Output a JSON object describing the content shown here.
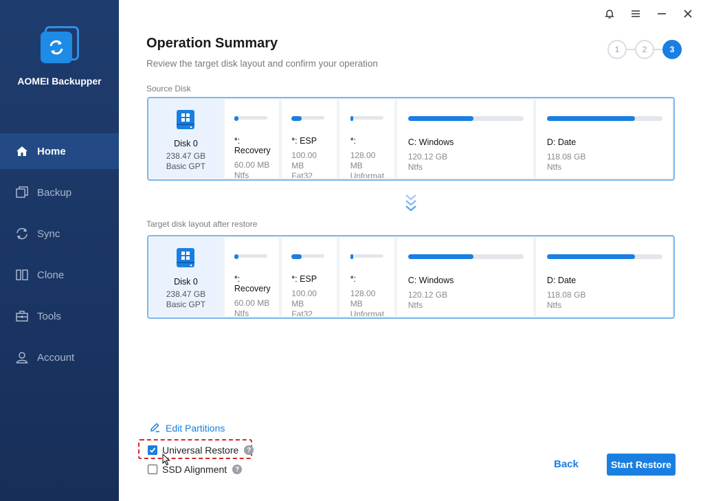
{
  "app": {
    "brand": "AOMEI Backupper"
  },
  "sidebar": {
    "items": [
      {
        "label": "Home",
        "icon": "home-icon",
        "active": true
      },
      {
        "label": "Backup",
        "icon": "backup-icon"
      },
      {
        "label": "Sync",
        "icon": "sync-icon"
      },
      {
        "label": "Clone",
        "icon": "clone-icon"
      },
      {
        "label": "Tools",
        "icon": "tools-icon"
      },
      {
        "label": "Account",
        "icon": "account-icon"
      }
    ]
  },
  "header": {
    "title": "Operation Summary",
    "subtitle": "Review the target disk layout and confirm your operation",
    "steps": [
      "1",
      "2",
      "3"
    ],
    "active_step": 3
  },
  "source": {
    "label": "Source Disk",
    "disk": {
      "name": "Disk 0",
      "size": "238.47 GB",
      "style": "Basic GPT"
    },
    "partitions": [
      {
        "name": "*: Recovery",
        "size": "60.00 MB",
        "fs": "Ntfs",
        "fill": 0.12
      },
      {
        "name": "*: ESP",
        "size": "100.00 MB",
        "fs": "Fat32",
        "fill": 0.3
      },
      {
        "name": "*:",
        "size": "128.00 MB",
        "fs": "Unformat...",
        "fill": 0.08
      },
      {
        "name": "C: Windows",
        "size": "120.12 GB",
        "fs": "Ntfs",
        "fill": 0.57
      },
      {
        "name": "D: Date",
        "size": "118.08 GB",
        "fs": "Ntfs",
        "fill": 0.76
      }
    ]
  },
  "target": {
    "label": "Target disk layout after restore",
    "disk": {
      "name": "Disk 0",
      "size": "238.47 GB",
      "style": "Basic GPT"
    },
    "partitions": [
      {
        "name": "*: Recovery",
        "size": "60.00 MB",
        "fs": "Ntfs",
        "fill": 0.12
      },
      {
        "name": "*: ESP",
        "size": "100.00 MB",
        "fs": "Fat32",
        "fill": 0.3
      },
      {
        "name": "*:",
        "size": "128.00 MB",
        "fs": "Unformat...",
        "fill": 0.08
      },
      {
        "name": "C: Windows",
        "size": "120.12 GB",
        "fs": "Ntfs",
        "fill": 0.57
      },
      {
        "name": "D: Date",
        "size": "118.08 GB",
        "fs": "Ntfs",
        "fill": 0.76
      }
    ]
  },
  "options": {
    "edit_partitions": "Edit Partitions",
    "universal_restore": {
      "label": "Universal Restore",
      "checked": true,
      "help": "?"
    },
    "ssd_alignment": {
      "label": "SSD Alignment",
      "checked": false,
      "help": "?"
    }
  },
  "actions": {
    "back": "Back",
    "start": "Start Restore"
  },
  "colors": {
    "accent": "#1a7fe0",
    "sidebar": "#1e3c6e",
    "highlight": "#d6262b"
  }
}
